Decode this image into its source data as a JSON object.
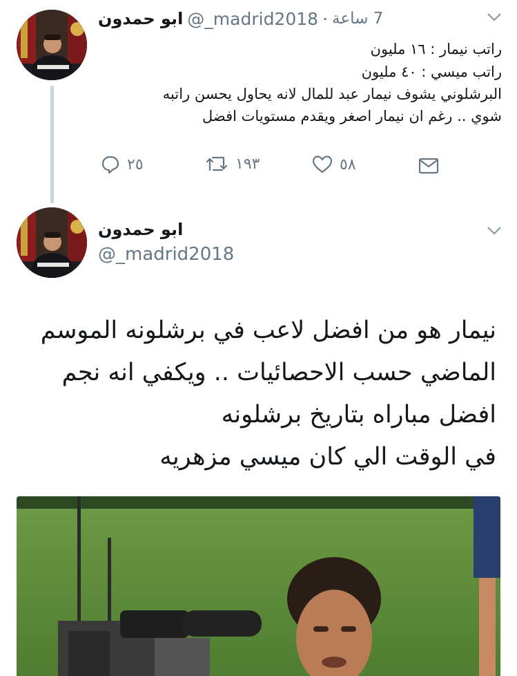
{
  "tweet1": {
    "name": "ابو حمدون",
    "handle": "@_madrid2018",
    "separator": "·",
    "time": "7 ساعة",
    "lines": [
      "راتب نيمار : ١٦ مليون",
      "راتب ميسي : ٤٠ مليون",
      "البرشلوني يشوف نيمار عبد للمال لانه يحاول يحسن راتبه",
      "شوي .. رغم ان نيمار اصغر ويقدم مستويات افضل"
    ],
    "actions": {
      "reply_count": "٢٥",
      "retweet_count": "١٩٣",
      "like_count": "٥٨"
    }
  },
  "tweet2": {
    "name": "ابو حمدون",
    "handle": "@_madrid2018",
    "lines": [
      "نيمار هو من افضل لاعب في برشلونه الموسم",
      "الماضي حسب الاحصائيات .. ويكفي انه نجم",
      "افضل مباراه بتاريخ برشلونه",
      "في الوقت الي كان ميسي مزهريه"
    ]
  },
  "icons": {
    "reply": "reply-icon",
    "retweet": "retweet-icon",
    "like": "heart-icon",
    "dm": "envelope-icon",
    "caret": "chevron-down-icon"
  },
  "colors": {
    "text": "#14171a",
    "secondary": "#657786",
    "thread_line": "#ccd6dd",
    "pitch": "#5c8a3a"
  }
}
